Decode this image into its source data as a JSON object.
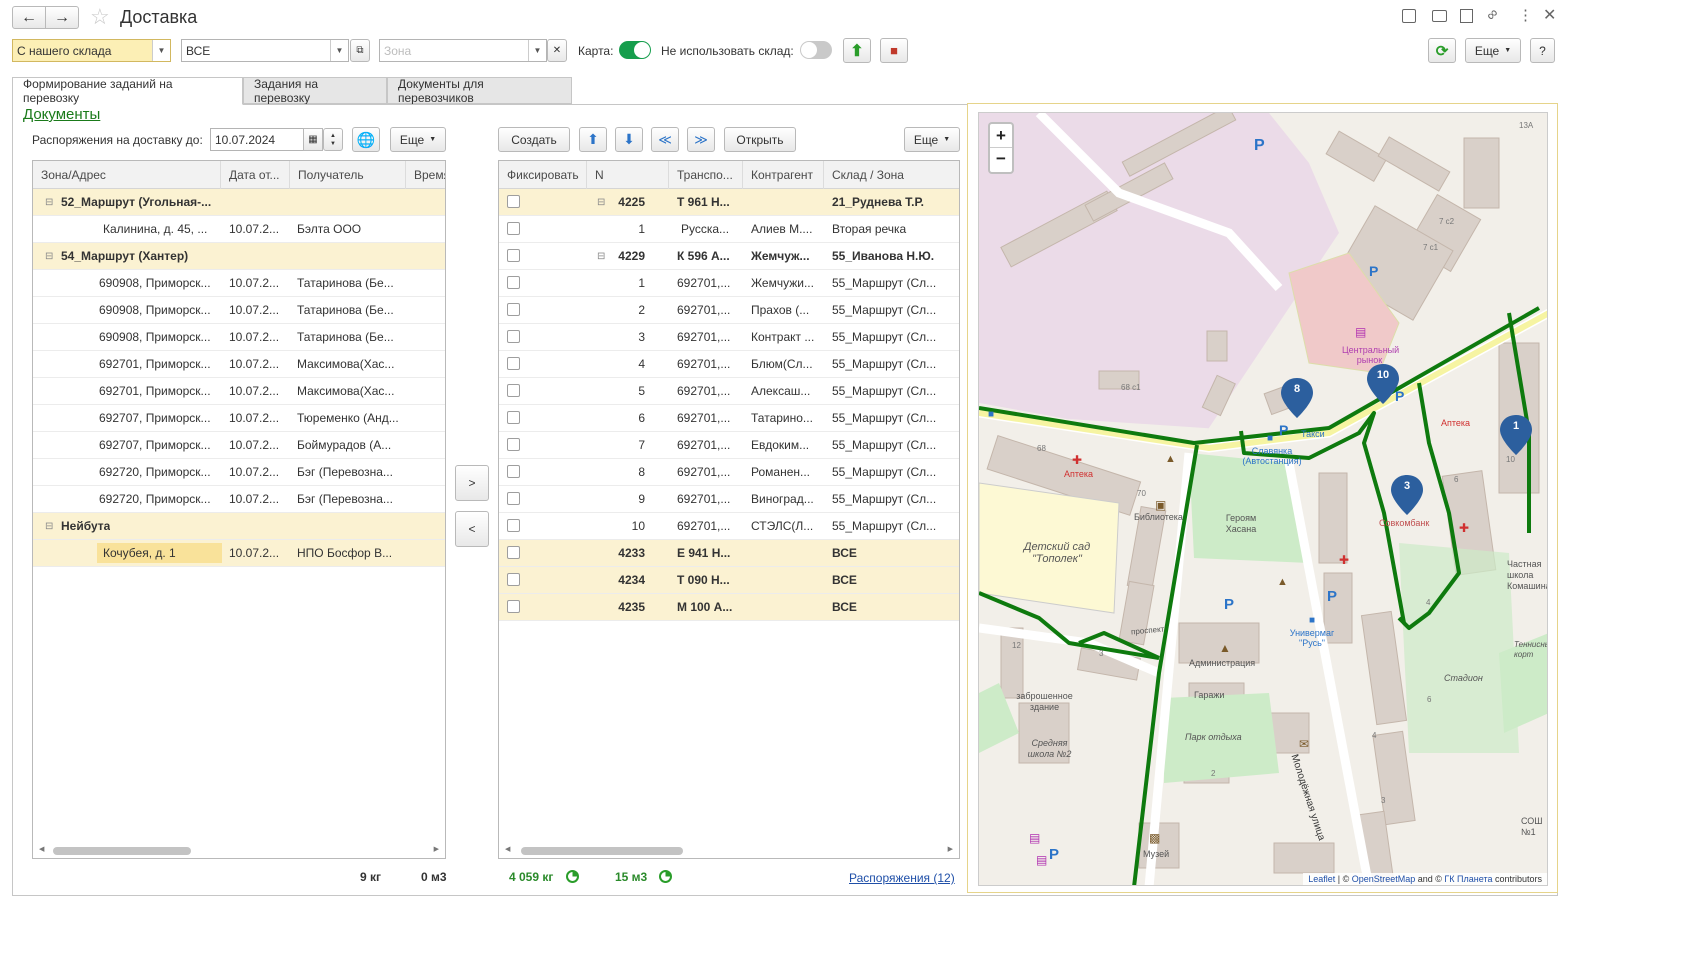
{
  "window": {
    "title": "Доставка"
  },
  "toolbar": {
    "warehouse_mode": "С нашего склада",
    "filter_value": "ВСЕ",
    "zone_placeholder": "Зона",
    "map_label": "Карта:",
    "no_warehouse_label": "Не использовать склад:",
    "more_label": "Еще",
    "help_label": "?"
  },
  "tabs": [
    {
      "label": "Формирование заданий на перевозку"
    },
    {
      "label": "Задания на перевозку"
    },
    {
      "label": "Документы для перевозчиков"
    }
  ],
  "left": {
    "documents_link": "Документы",
    "date_label": "Распоряжения на доставку до:",
    "date_value": "10.07.2024",
    "more_label": "Еще",
    "columns": [
      "Зона/Адрес",
      "Дата от...",
      "Получатель",
      "Время"
    ],
    "rows": [
      {
        "type": "group",
        "addr": "52_Маршрут (Угольная-...",
        "date": "",
        "recv": ""
      },
      {
        "type": "item",
        "addr": "Калинина, д. 45, ...",
        "date": "10.07.2...",
        "recv": "Бэлта  ООО"
      },
      {
        "type": "group",
        "addr": "54_Маршрут (Хантер)",
        "date": "",
        "recv": ""
      },
      {
        "type": "item",
        "addr": "690908, Приморск...",
        "date": "10.07.2...",
        "recv": "Татаринова (Бе..."
      },
      {
        "type": "item",
        "addr": "690908, Приморск...",
        "date": "10.07.2...",
        "recv": "Татаринова (Бе..."
      },
      {
        "type": "item",
        "addr": "690908, Приморск...",
        "date": "10.07.2...",
        "recv": "Татаринова (Бе..."
      },
      {
        "type": "item",
        "addr": "692701, Приморск...",
        "date": "10.07.2...",
        "recv": "Максимова(Хас..."
      },
      {
        "type": "item",
        "addr": "692701, Приморск...",
        "date": "10.07.2...",
        "recv": "Максимова(Хас..."
      },
      {
        "type": "item",
        "addr": "692707, Приморск...",
        "date": "10.07.2...",
        "recv": "Тюременко (Анд..."
      },
      {
        "type": "item",
        "addr": "692707, Приморск...",
        "date": "10.07.2...",
        "recv": "Боймурадов (А..."
      },
      {
        "type": "item",
        "addr": "692720, Приморск...",
        "date": "10.07.2...",
        "recv": "Бэг (Перевозна..."
      },
      {
        "type": "item",
        "addr": "692720, Приморск...",
        "date": "10.07.2...",
        "recv": "Бэг (Перевозна..."
      },
      {
        "type": "group",
        "addr": "Нейбута",
        "date": "",
        "recv": ""
      },
      {
        "type": "selected",
        "addr": "Кочубея, д. 1",
        "date": "10.07.2...",
        "recv": "НПО Босфор В..."
      }
    ],
    "total_weight": "9 кг",
    "total_volume": "0 м3"
  },
  "middle": {
    "move_right": ">",
    "move_left": "<"
  },
  "right": {
    "create_label": "Создать",
    "open_label": "Открыть",
    "more_label": "Еще",
    "columns": [
      "Фиксировать",
      "N",
      "Транспо...",
      "Контрагент",
      "Склад / Зона"
    ],
    "rows": [
      {
        "type": "group",
        "n": "4225",
        "tr": "Т 961 Н...",
        "ka": "",
        "zone": "21_Руднева Т.Р.",
        "expand": true
      },
      {
        "type": "item",
        "n": "1",
        "tr": "Русска...",
        "ka": "Алиев М....",
        "zone": "Вторая речка"
      },
      {
        "type": "plain-bold",
        "n": "4229",
        "tr": "К 596 А...",
        "ka": "Жемчуж...",
        "zone": "55_Иванова Н.Ю.",
        "expand": true
      },
      {
        "type": "item",
        "n": "1",
        "tr": "692701,...",
        "ka": "Жемчужи...",
        "zone": "55_Маршрут (Сл..."
      },
      {
        "type": "item",
        "n": "2",
        "tr": "692701,...",
        "ka": "Прахов (...",
        "zone": "55_Маршрут (Сл..."
      },
      {
        "type": "item",
        "n": "3",
        "tr": "692701,...",
        "ka": "Контракт ...",
        "zone": "55_Маршрут (Сл..."
      },
      {
        "type": "item",
        "n": "4",
        "tr": "692701,...",
        "ka": "Блюм(Сл...",
        "zone": "55_Маршрут (Сл..."
      },
      {
        "type": "item",
        "n": "5",
        "tr": "692701,...",
        "ka": "Алексаш...",
        "zone": "55_Маршрут (Сл..."
      },
      {
        "type": "item",
        "n": "6",
        "tr": "692701,...",
        "ka": "Татарино...",
        "zone": "55_Маршрут (Сл..."
      },
      {
        "type": "item",
        "n": "7",
        "tr": "692701,...",
        "ka": "Евдоким...",
        "zone": "55_Маршрут (Сл..."
      },
      {
        "type": "item",
        "n": "8",
        "tr": "692701,...",
        "ka": "Романен...",
        "zone": "55_Маршрут (Сл..."
      },
      {
        "type": "item",
        "n": "9",
        "tr": "692701,...",
        "ka": "Виноград...",
        "zone": "55_Маршрут (Сл..."
      },
      {
        "type": "item",
        "n": "10",
        "tr": "692701,...",
        "ka": "СТЭЛС(Л...",
        "zone": "55_Маршрут (Сл..."
      },
      {
        "type": "group",
        "n": "4233",
        "tr": "Е 941 Н...",
        "ka": "",
        "zone": "ВСЕ"
      },
      {
        "type": "group",
        "n": "4234",
        "tr": "Т 090 Н...",
        "ka": "",
        "zone": "ВСЕ"
      },
      {
        "type": "group",
        "n": "4235",
        "tr": "М 100 А...",
        "ka": "",
        "zone": "ВСЕ"
      }
    ],
    "total_weight": "4 059 кг",
    "total_volume": "15 м3",
    "orders_link": "Распоряжения (12)"
  },
  "map": {
    "zoom_in": "+",
    "zoom_out": "−",
    "labels": {
      "market": "Центральный рынок",
      "pharmacy1": "Аптека",
      "pharmacy2": "Аптека",
      "library": "Библиотека",
      "heroes": "Героям Хасана",
      "kindergarten": "Детский сад \"Тополек\"",
      "admin": "Администрация",
      "abandoned": "заброшенное здание",
      "garages": "Гаражи",
      "school": "Средняя школа №2",
      "park": "Парк отдыха",
      "museum": "Музей",
      "univermag": "Универмаг \"Русь\"",
      "molod_street": "Молодёжная улица",
      "sovcombank": "Совкомбанк",
      "stadium": "Стадион",
      "private_school": "Частная школа Комашина",
      "tennis": "Теннисный корт",
      "sosh": "СОШ №1",
      "bus": "Славянка (Автостанция)",
      "taxi": "Такси",
      "prospekt": "проспект"
    },
    "house_numbers": [
      "68 с1",
      "68",
      "70",
      "13А",
      "7 с2",
      "7 с1",
      "12",
      "3",
      "2",
      "10",
      "6",
      "4",
      "6",
      "4",
      "3"
    ],
    "markers": [
      "8",
      "10",
      "1",
      "3"
    ],
    "attribution_leaflet": "Leaflet",
    "attribution_sep": " | © ",
    "attribution_osm": "OpenStreetMap",
    "attribution_and": " and © ",
    "attribution_gk": "ГК Планета",
    "attribution_end": " contributors"
  }
}
